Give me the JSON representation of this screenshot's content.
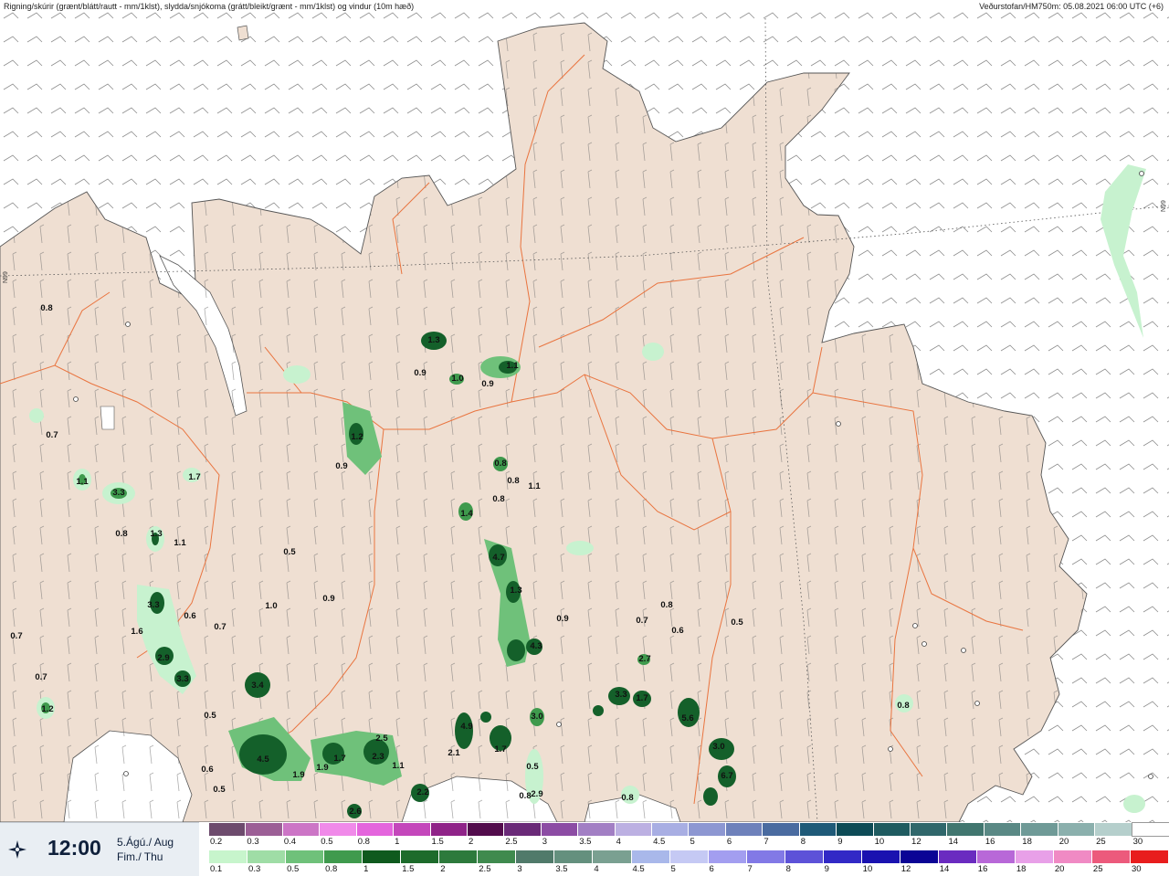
{
  "header": {
    "left_text": "Rigning/skúrir (grænt/blátt/rautt - mm/1klst), slydda/snjókoma (grátt/bleikt/grænt - mm/1klst) og vindur (10m hæð)",
    "right_text": "Veðurstofan/HM750m: 05.08.2021 06:00 UTC (+6)"
  },
  "grid_labels": {
    "left": "N99",
    "right": "N99"
  },
  "info": {
    "time": "12:00",
    "date_line1": "5.Ágú./ Aug",
    "date_line2": "Fim./ Thu",
    "icon": "compass-icon"
  },
  "colors": {
    "land": "#efdfd2",
    "sea": "#ffffff",
    "roads": "#e9743f",
    "precip_light": "#c7f2cf",
    "precip_mid": "#6fc17a",
    "precip_dark": "#14602a"
  },
  "legend": {
    "top_row": {
      "labels": [
        "0.2",
        "0.3",
        "0.4",
        "0.5",
        "0.8",
        "1",
        "1.5",
        "2",
        "2.5",
        "3",
        "3.5",
        "4",
        "4.5",
        "5",
        "6",
        "7",
        "8",
        "9",
        "10",
        "12",
        "14",
        "16",
        "18",
        "20",
        "25",
        "30"
      ],
      "colors": [
        "#6d4b6d",
        "#9c5f96",
        "#cc75c6",
        "#f08ae9",
        "#e465dd",
        "#c447bb",
        "#8f2388",
        "#520c4c",
        "#6a2a78",
        "#8c4ca4",
        "#a27fc4",
        "#bcb0e2",
        "#a8aee3",
        "#8d97d2",
        "#6e81bb",
        "#4a6ba0",
        "#1f5a78",
        "#0d4b56",
        "#1f5b60",
        "#30676b",
        "#41766f",
        "#5a8985",
        "#6f9a97",
        "#8bb0ad",
        "#b5cfcc",
        "#ffffff"
      ]
    },
    "bottom_row": {
      "labels": [
        "0.1",
        "0.3",
        "0.5",
        "0.8",
        "1",
        "1.5",
        "2",
        "2.5",
        "3",
        "3.5",
        "4",
        "4.5",
        "5",
        "6",
        "7",
        "8",
        "9",
        "10",
        "12",
        "14",
        "16",
        "18",
        "20",
        "25",
        "30"
      ],
      "colors": [
        "#c7f5cc",
        "#9fdda6",
        "#6fc17a",
        "#3f9a4d",
        "#0f5a1e",
        "#1d6b2b",
        "#2d7a3c",
        "#3f8a4e",
        "#507a6a",
        "#64907e",
        "#7aa091",
        "#a9b8ea",
        "#c5c9f4",
        "#a39ef0",
        "#8279e6",
        "#5d52d8",
        "#3229c6",
        "#1a12b0",
        "#0b0495",
        "#6a2bc0",
        "#b868d8",
        "#e8a0e8",
        "#f08ac4",
        "#ec5a7c",
        "#e81d1d"
      ]
    }
  },
  "values": [
    {
      "v": "0.8"
    },
    {
      "v": "0.7"
    },
    {
      "v": "1.1"
    },
    {
      "v": "3.3"
    },
    {
      "v": "1.7"
    },
    {
      "v": "0.8"
    },
    {
      "v": "1.3"
    },
    {
      "v": "1.1"
    },
    {
      "v": "0.5"
    },
    {
      "v": "1.0"
    },
    {
      "v": "0.9"
    },
    {
      "v": "0.6"
    },
    {
      "v": "0.7"
    },
    {
      "v": "3.3"
    },
    {
      "v": "1.6"
    },
    {
      "v": "2.9"
    },
    {
      "v": "3.3"
    },
    {
      "v": "0.7"
    },
    {
      "v": "0.7"
    },
    {
      "v": "1.2"
    },
    {
      "v": "0.5"
    },
    {
      "v": "3.4"
    },
    {
      "v": "4.5"
    },
    {
      "v": "1.9"
    },
    {
      "v": "0.6"
    },
    {
      "v": "0.5"
    },
    {
      "v": "1.9"
    },
    {
      "v": "1.7"
    },
    {
      "v": "2.5"
    },
    {
      "v": "2.3"
    },
    {
      "v": "1.1"
    },
    {
      "v": "2.2"
    },
    {
      "v": "2.6"
    },
    {
      "v": "1.3"
    },
    {
      "v": "0.9"
    },
    {
      "v": "1.0"
    },
    {
      "v": "0.9"
    },
    {
      "v": "1.1"
    },
    {
      "v": "1.2"
    },
    {
      "v": "0.9"
    },
    {
      "v": "0.8"
    },
    {
      "v": "0.8"
    },
    {
      "v": "1.1"
    },
    {
      "v": "0.8"
    },
    {
      "v": "1.4"
    },
    {
      "v": "4.7"
    },
    {
      "v": "1.3"
    },
    {
      "v": "4.3"
    },
    {
      "v": "0.9"
    },
    {
      "v": "0.7"
    },
    {
      "v": "0.8"
    },
    {
      "v": "0.6"
    },
    {
      "v": "0.5"
    },
    {
      "v": "2.7"
    },
    {
      "v": "3.3"
    },
    {
      "v": "1.7"
    },
    {
      "v": "5.6"
    },
    {
      "v": "3.0"
    },
    {
      "v": "6.7"
    },
    {
      "v": "3.0"
    },
    {
      "v": "4.9"
    },
    {
      "v": "2.1"
    },
    {
      "v": "1.7"
    },
    {
      "v": "0.5"
    },
    {
      "v": "0.8"
    },
    {
      "v": "0.8"
    },
    {
      "v": "0.8"
    },
    {
      "v": "2.9"
    }
  ]
}
